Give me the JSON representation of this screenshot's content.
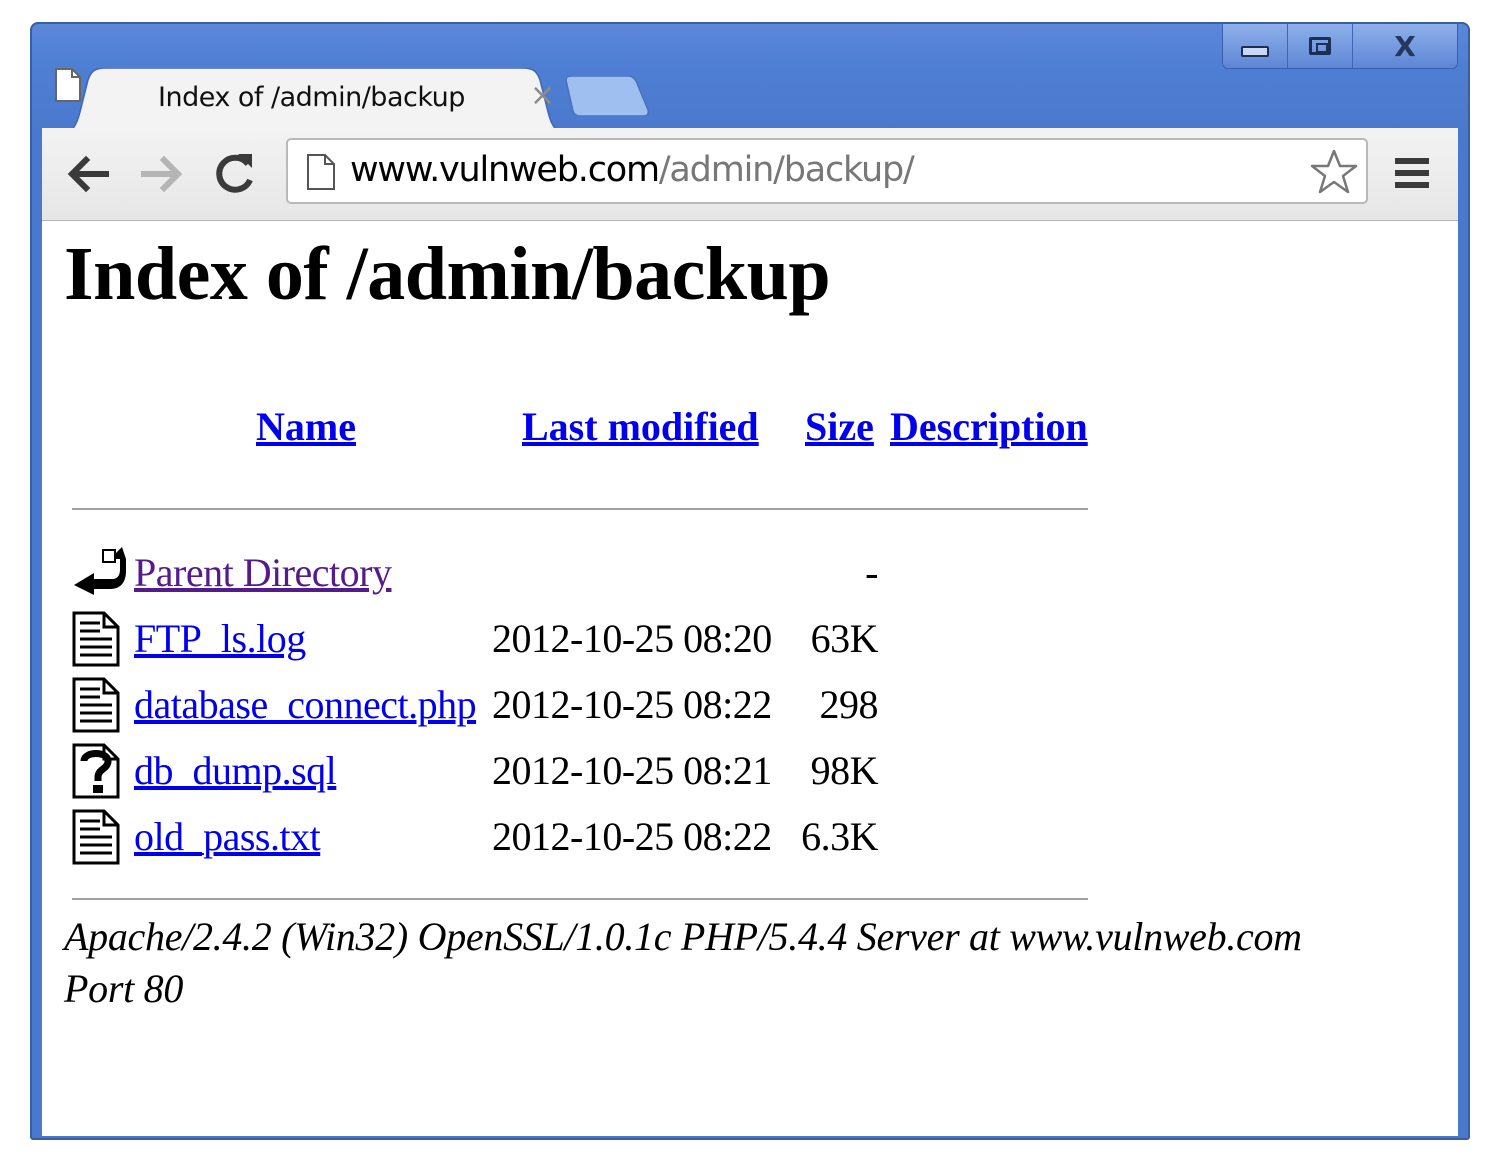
{
  "tab": {
    "title": "Index of /admin/backup",
    "close_glyph": "×"
  },
  "window_controls": {
    "close_glyph": "X"
  },
  "omnibox": {
    "host": "www.vulnweb.com",
    "path": "/admin/backup/"
  },
  "page": {
    "heading": "Index of /admin/backup",
    "columns": {
      "name": "Name",
      "last_modified": "Last modified",
      "size": "Size",
      "description": "Description"
    },
    "entries": [
      {
        "name": "Parent Directory",
        "date": "",
        "size": "-",
        "icon": "parent-directory-icon"
      },
      {
        "name": "FTP_ls.log",
        "date": "2012-10-25 08:20",
        "size": "63K",
        "icon": "text-file-icon"
      },
      {
        "name": "database_connect.php",
        "date": "2012-10-25 08:22",
        "size": "298",
        "icon": "text-file-icon"
      },
      {
        "name": "db_dump.sql",
        "date": "2012-10-25 08:21",
        "size": "98K",
        "icon": "unknown-file-icon"
      },
      {
        "name": "old_pass.txt",
        "date": "2012-10-25 08:22",
        "size": "6.3K",
        "icon": "text-file-icon"
      }
    ],
    "address_line1": "Apache/2.4.2 (Win32) OpenSSL/1.0.1c PHP/5.4.4 Server at www.vulnweb.com",
    "address_line2": "Port 80"
  },
  "colors": {
    "frame": "#4f7fd4",
    "link": "#0000ee",
    "visited_link": "#551a8b"
  }
}
